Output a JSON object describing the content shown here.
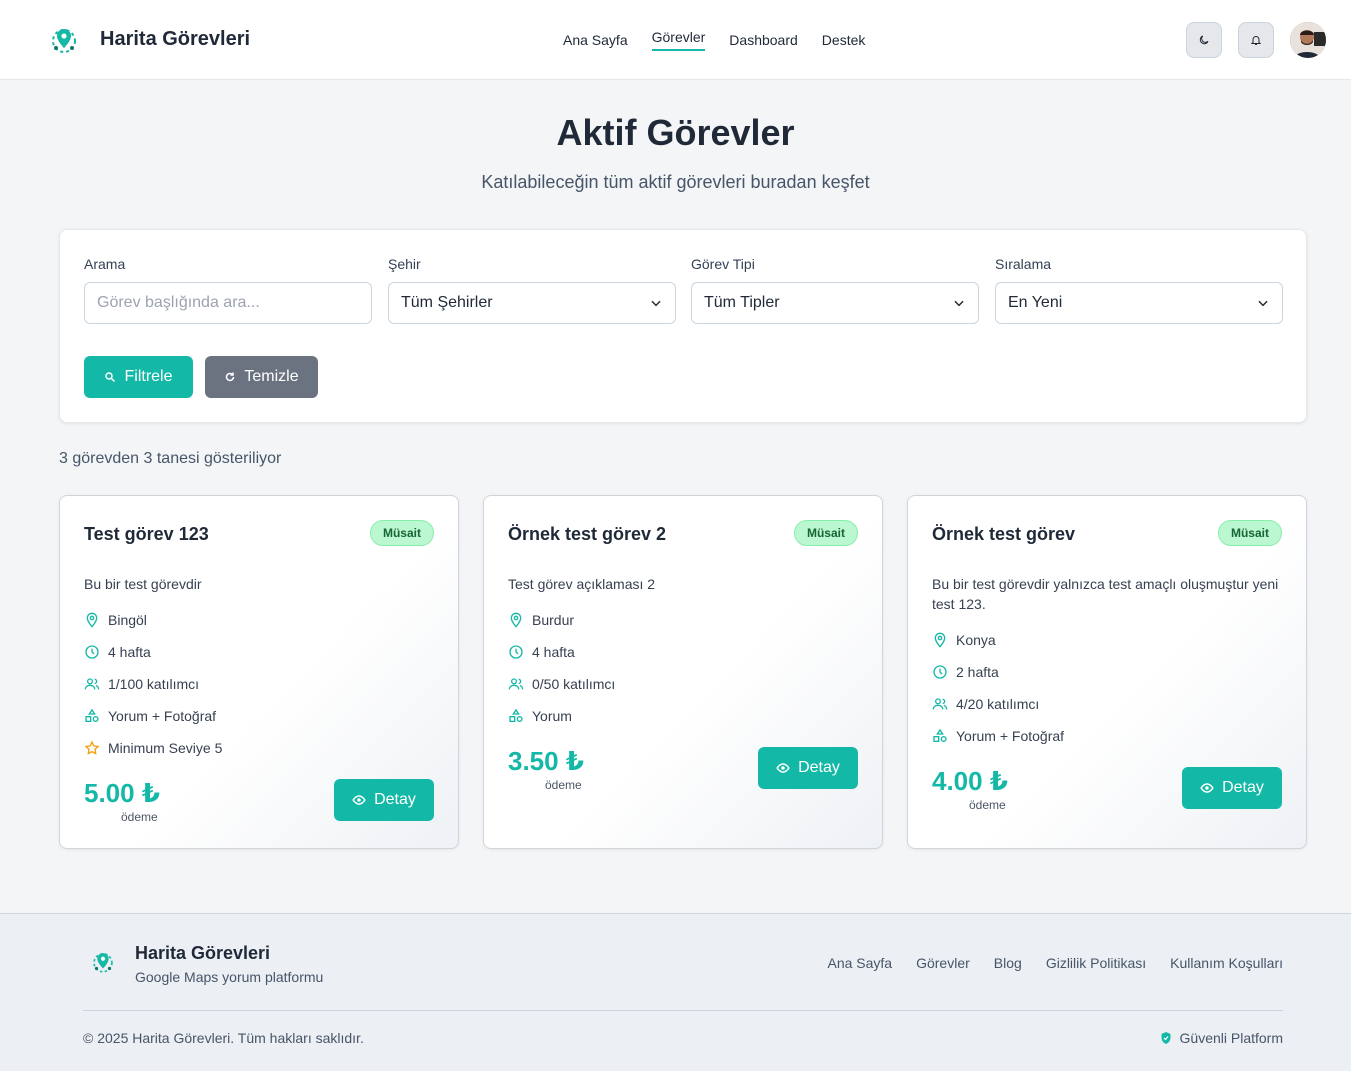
{
  "header": {
    "brand": "Harita Görevleri",
    "nav": [
      "Ana Sayfa",
      "Görevler",
      "Dashboard",
      "Destek"
    ],
    "active_nav": "Görevler"
  },
  "hero": {
    "title": "Aktif Görevler",
    "subtitle": "Katılabileceğin tüm aktif görevleri buradan keşfet"
  },
  "filters": {
    "search_label": "Arama",
    "search_placeholder": "Görev başlığında ara...",
    "city_label": "Şehir",
    "city_value": "Tüm Şehirler",
    "type_label": "Görev Tipi",
    "type_value": "Tüm Tipler",
    "sort_label": "Sıralama",
    "sort_value": "En Yeni",
    "filter_button": "Filtrele",
    "clear_button": "Temizle"
  },
  "results_text": "3 görevden 3 tanesi gösteriliyor",
  "tasks": [
    {
      "title": "Test görev 123",
      "status": "Müsait",
      "description": "Bu bir test görevdir",
      "city": "Bingöl",
      "duration": "4 hafta",
      "participants": "1/100 katılımcı",
      "type": "Yorum + Fotoğraf",
      "level": "Minimum Seviye 5",
      "price": "5.00 ₺",
      "price_label": "ödeme",
      "detail_button": "Detay"
    },
    {
      "title": "Örnek test görev 2",
      "status": "Müsait",
      "description": "Test görev açıklaması 2",
      "city": "Burdur",
      "duration": "4 hafta",
      "participants": "0/50 katılımcı",
      "type": "Yorum",
      "price": "3.50 ₺",
      "price_label": "ödeme",
      "detail_button": "Detay"
    },
    {
      "title": "Örnek test görev",
      "status": "Müsait",
      "description": "Bu bir test görevdir yalnızca test amaçlı oluşmuştur yeni test 123.",
      "city": "Konya",
      "duration": "2 hafta",
      "participants": "4/20 katılımcı",
      "type": "Yorum + Fotoğraf",
      "price": "4.00 ₺",
      "price_label": "ödeme",
      "detail_button": "Detay"
    }
  ],
  "footer": {
    "brand": "Harita Görevleri",
    "tagline": "Google Maps yorum platformu",
    "links": [
      "Ana Sayfa",
      "Görevler",
      "Blog",
      "Gizlilik Politikası",
      "Kullanım Koşulları"
    ],
    "copyright": "© 2025 Harita Görevleri. Tüm hakları saklıdır.",
    "secure_label": "Güvenli Platform"
  },
  "colors": {
    "accent": "#14b8a6",
    "badge_bg": "#bbf7d0",
    "secondary_button": "#6b7280"
  }
}
